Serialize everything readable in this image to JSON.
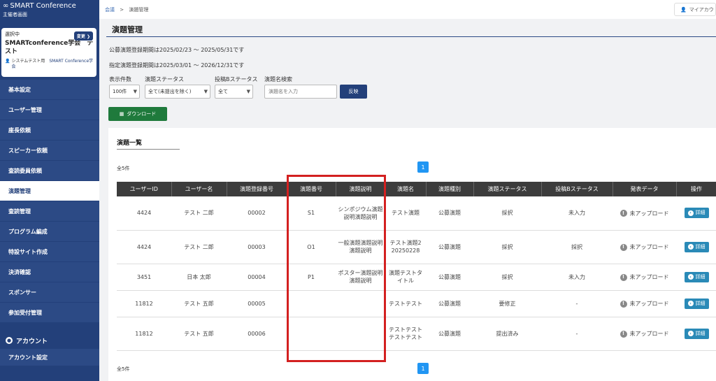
{
  "brand": {
    "title": "SMART Conference",
    "subtitle": "主催者画面"
  },
  "selected": {
    "label": "選択中",
    "change_label": "変更 ❯",
    "name": "SMARTconference学会　テスト",
    "user_name": "システムテスト用",
    "user_org": "SMART Conference学会"
  },
  "nav": [
    {
      "label": "基本設定",
      "active": false
    },
    {
      "label": "ユーザー管理",
      "active": false
    },
    {
      "label": "座長依頼",
      "active": false
    },
    {
      "label": "スピーカー依頼",
      "active": false
    },
    {
      "label": "査読委員依頼",
      "active": false
    },
    {
      "label": "演題管理",
      "active": true
    },
    {
      "label": "査読管理",
      "active": false
    },
    {
      "label": "プログラム編成",
      "active": false
    },
    {
      "label": "特設サイト作成",
      "active": false
    },
    {
      "label": "決済確認",
      "active": false
    },
    {
      "label": "スポンサー",
      "active": false
    },
    {
      "label": "参加受付管理",
      "active": false
    }
  ],
  "account_section": {
    "header": "アカウント",
    "item": "アカウント設定"
  },
  "breadcrumb": {
    "root": "会議",
    "sep": ">",
    "current": "演題管理"
  },
  "topbar": {
    "account_label": "マイアカウ"
  },
  "page_title": "演題管理",
  "periods": [
    "公募演題登録期間は2025/02/23 〜 2025/05/31です",
    "指定演題登録期間は2025/03/01 〜 2026/12/31です"
  ],
  "filters": {
    "count_label": "表示件数",
    "count_value": "100件",
    "status_label": "演題ステータス",
    "status_value": "全て(未提出を除く)",
    "b_status_label": "投稿Bステータス",
    "b_status_value": "全て",
    "search_label": "演題名検索",
    "search_placeholder": "演題名を入力",
    "apply_label": "反映"
  },
  "download_label": "ダウンロード",
  "list": {
    "title": "演題一覧",
    "count_text": "全5件",
    "page": "1",
    "headers": [
      "ユーザーID",
      "ユーザー名",
      "演題登録番号",
      "演題番号",
      "演題説明",
      "演題名",
      "演題種別",
      "演題ステータス",
      "投稿Bステータス",
      "発表データ",
      "操作"
    ],
    "detail_label": "詳細",
    "rows": [
      {
        "user_id": "4424",
        "user_name": "テスト 二郎",
        "reg_no": "00002",
        "abstract_no": "S1",
        "description": "シンポジウム演題説明演題説明",
        "title": "テスト演題",
        "type": "公募演題",
        "status": "採択",
        "b_status": "未入力",
        "upload": "未アップロード"
      },
      {
        "user_id": "4424",
        "user_name": "テスト 二郎",
        "reg_no": "00003",
        "abstract_no": "O1",
        "description": "一般演題演題説明演題説明",
        "title": "テスト演題2　20250228",
        "type": "公募演題",
        "status": "採択",
        "b_status": "採択",
        "upload": "未アップロード"
      },
      {
        "user_id": "3451",
        "user_name": "日本 太郎",
        "reg_no": "00004",
        "abstract_no": "P1",
        "description": "ポスター演題説明演題説明",
        "title": "演題テストタイトル",
        "type": "公募演題",
        "status": "採択",
        "b_status": "未入力",
        "upload": "未アップロード"
      },
      {
        "user_id": "11812",
        "user_name": "テスト 五郎",
        "reg_no": "00005",
        "abstract_no": "",
        "description": "",
        "title": "テストテスト",
        "type": "公募演題",
        "status": "要修正",
        "b_status": "-",
        "upload": "未アップロード"
      },
      {
        "user_id": "11812",
        "user_name": "テスト 五郎",
        "reg_no": "00006",
        "abstract_no": "",
        "description": "",
        "title": "テストテストテストテスト",
        "type": "公募演題",
        "status": "提出済み",
        "b_status": "-",
        "upload": "未アップロード"
      }
    ]
  },
  "highlight_color": "#d32020"
}
